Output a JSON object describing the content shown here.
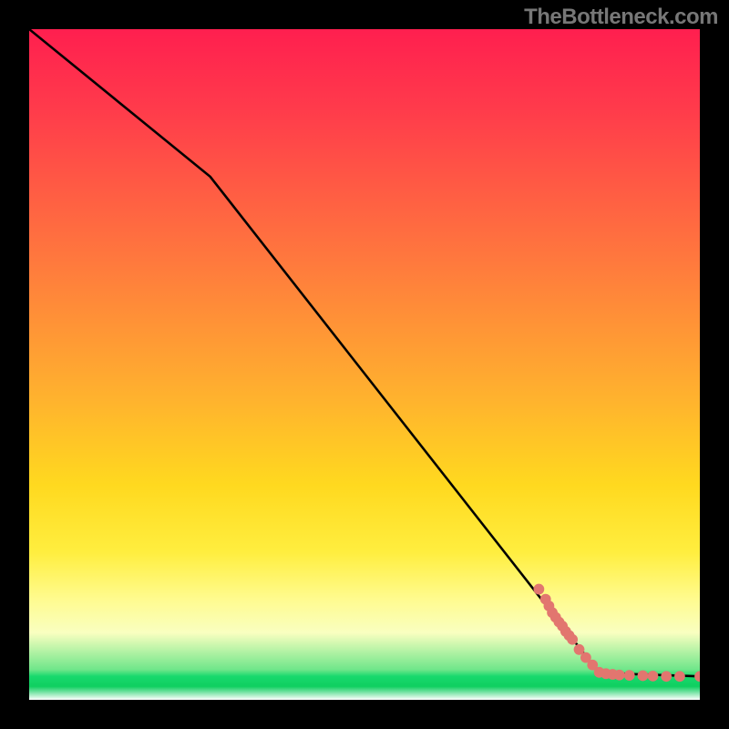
{
  "attribution": "TheBottleneck.com",
  "chart_data": {
    "type": "line",
    "title": "",
    "xlabel": "",
    "ylabel": "",
    "xlim": [
      0,
      100
    ],
    "ylim": [
      0,
      100
    ],
    "line": {
      "points": [
        {
          "x": 0,
          "y": 100
        },
        {
          "x": 27,
          "y": 78
        },
        {
          "x": 85,
          "y": 4
        },
        {
          "x": 100,
          "y": 3.5
        }
      ],
      "color": "#000000"
    },
    "markers": {
      "color": "#e2766f",
      "radius_pct": 0.8,
      "points": [
        {
          "x": 76,
          "y": 16.5
        },
        {
          "x": 77,
          "y": 15
        },
        {
          "x": 77.5,
          "y": 14
        },
        {
          "x": 78,
          "y": 13
        },
        {
          "x": 78.5,
          "y": 12.3
        },
        {
          "x": 79,
          "y": 11.6
        },
        {
          "x": 79.5,
          "y": 11
        },
        {
          "x": 80,
          "y": 10.2
        },
        {
          "x": 80.5,
          "y": 9.6
        },
        {
          "x": 81,
          "y": 9
        },
        {
          "x": 82,
          "y": 7.5
        },
        {
          "x": 83,
          "y": 6.3
        },
        {
          "x": 84,
          "y": 5.2
        },
        {
          "x": 85,
          "y": 4.1
        },
        {
          "x": 86,
          "y": 3.9
        },
        {
          "x": 87,
          "y": 3.8
        },
        {
          "x": 88,
          "y": 3.7
        },
        {
          "x": 89.5,
          "y": 3.65
        },
        {
          "x": 91.5,
          "y": 3.6
        },
        {
          "x": 93,
          "y": 3.55
        },
        {
          "x": 95,
          "y": 3.5
        },
        {
          "x": 97,
          "y": 3.5
        },
        {
          "x": 100,
          "y": 3.5
        }
      ]
    },
    "background_gradient_stops": [
      {
        "pos": 0.0,
        "color": "#ff1f4f"
      },
      {
        "pos": 0.55,
        "color": "#ffd91f"
      },
      {
        "pos": 0.9,
        "color": "#f9ffc0"
      },
      {
        "pos": 0.97,
        "color": "#18d96d"
      },
      {
        "pos": 1.0,
        "color": "#ffffff"
      }
    ]
  }
}
